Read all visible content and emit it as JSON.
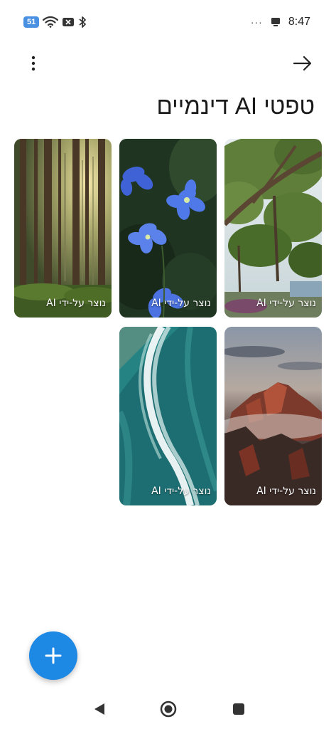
{
  "status_bar": {
    "signal_badge": "51",
    "time": "8:47",
    "overflow": "···",
    "icons": [
      "wifi-icon",
      "notification-off-icon",
      "bluetooth-icon",
      "cast-icon"
    ]
  },
  "header": {
    "title": "טפטי AI דינמיים",
    "more_icon": "more-vert-icon",
    "back_icon": "arrow-forward-icon"
  },
  "wallpapers": [
    {
      "name": "tree",
      "label": "נוצר על-ידי AI"
    },
    {
      "name": "flowers",
      "label": "נוצר על-ידי AI"
    },
    {
      "name": "forest",
      "label": "נוצר על-ידי AI"
    },
    {
      "name": "mountain",
      "label": "נוצר על-ידי AI"
    },
    {
      "name": "ocean",
      "label": "נוצר על-ידי AI"
    }
  ],
  "fab": {
    "icon": "plus-icon",
    "color": "#1e88e5"
  },
  "nav_bar": {
    "back_icon": "triangle-back-icon",
    "home_icon": "circle-home-icon",
    "recent_icon": "square-recent-icon"
  }
}
